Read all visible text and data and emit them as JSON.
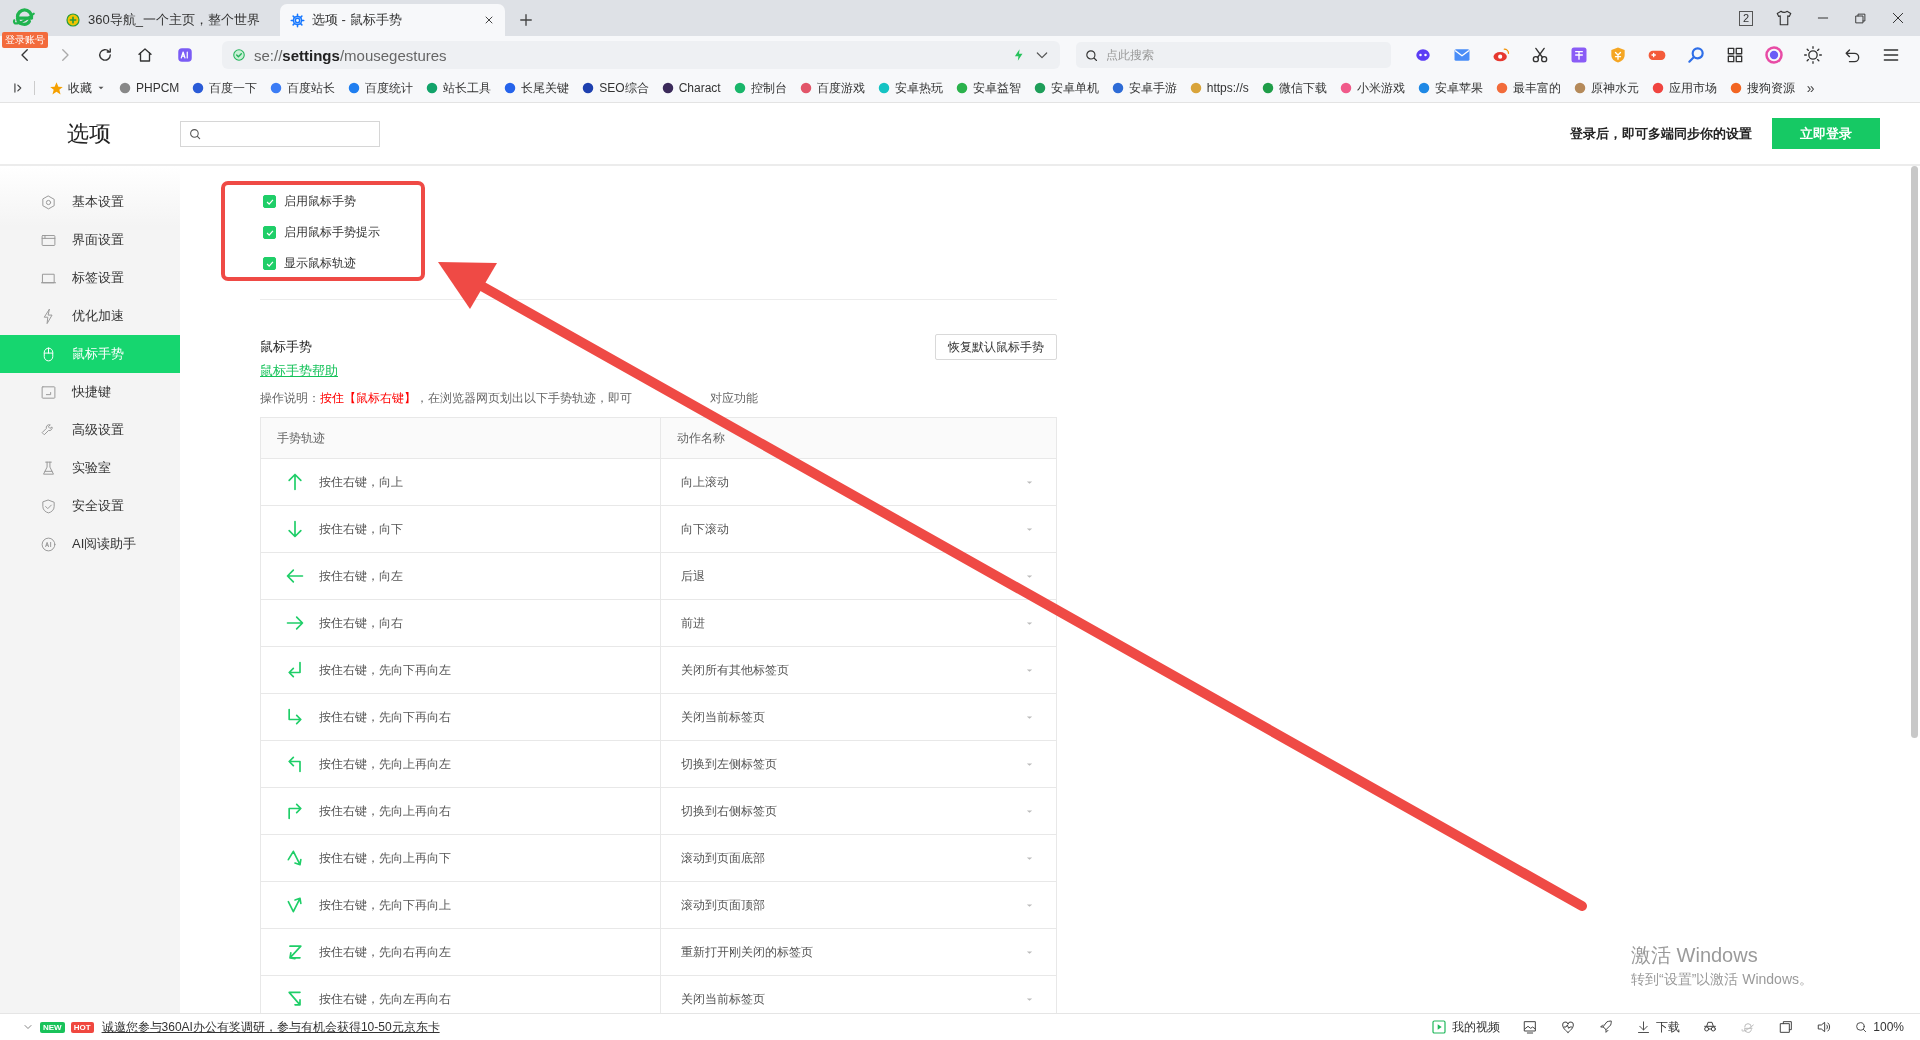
{
  "browser": {
    "account_badge": "登录账号",
    "tabs": [
      {
        "title": "360导航_一个主页，整个世界",
        "selected": false
      },
      {
        "title": "选项 - 鼠标手势",
        "selected": true
      }
    ],
    "tab_count": "2",
    "address": {
      "scheme": "se://",
      "host": "settings",
      "path": "/mousegestures"
    },
    "search": {
      "placeholder": "点此搜索"
    },
    "bookmarks": [
      {
        "label": "收藏"
      },
      {
        "label": "PHPCM"
      },
      {
        "label": "百度一下"
      },
      {
        "label": "百度站长"
      },
      {
        "label": "百度统计"
      },
      {
        "label": "站长工具"
      },
      {
        "label": "长尾关键"
      },
      {
        "label": "SEO综合"
      },
      {
        "label": "Charact"
      },
      {
        "label": "控制台"
      },
      {
        "label": "百度游戏"
      },
      {
        "label": "安卓热玩"
      },
      {
        "label": "安卓益智"
      },
      {
        "label": "安卓单机"
      },
      {
        "label": "安卓手游"
      },
      {
        "label": "https://s"
      },
      {
        "label": "微信下载"
      },
      {
        "label": "小米游戏"
      },
      {
        "label": "安卓苹果"
      },
      {
        "label": "最丰富的"
      },
      {
        "label": "原神水元"
      },
      {
        "label": "应用市场"
      },
      {
        "label": "搜狗资源"
      }
    ],
    "more": "»"
  },
  "settings": {
    "title": "选项",
    "sync_hint": "登录后，即可多端同步你的设置",
    "login_button": "立即登录",
    "sidebar": [
      {
        "label": "基本设置",
        "selected": false
      },
      {
        "label": "界面设置",
        "selected": false
      },
      {
        "label": "标签设置",
        "selected": false
      },
      {
        "label": "优化加速",
        "selected": false
      },
      {
        "label": "鼠标手势",
        "selected": true
      },
      {
        "label": "快捷键",
        "selected": false
      },
      {
        "label": "高级设置",
        "selected": false
      },
      {
        "label": "实验室",
        "selected": false
      },
      {
        "label": "安全设置",
        "selected": false
      },
      {
        "label": "AI阅读助手",
        "selected": false
      }
    ],
    "checkboxes": [
      {
        "label": "启用鼠标手势",
        "checked": true
      },
      {
        "label": "启用鼠标手势提示",
        "checked": true
      },
      {
        "label": "显示鼠标轨迹",
        "checked": true
      }
    ],
    "section_title": "鼠标手势",
    "reset_button": "恢复默认鼠标手势",
    "help_link": "鼠标手势帮助",
    "instruction": {
      "prefix": "操作说明：",
      "highlight": "按住【鼠标右键】",
      "rest": "，在浏览器网页划出以下手势轨迹，即可",
      "tail": "对应功能"
    },
    "table": {
      "columns": [
        "手势轨迹",
        "动作名称"
      ],
      "rows": [
        {
          "kind": "up",
          "gesture": "按住右键，向上",
          "action": "向上滚动"
        },
        {
          "kind": "down",
          "gesture": "按住右键，向下",
          "action": "向下滚动"
        },
        {
          "kind": "left",
          "gesture": "按住右键，向左",
          "action": "后退"
        },
        {
          "kind": "right",
          "gesture": "按住右键，向右",
          "action": "前进"
        },
        {
          "kind": "down-left",
          "gesture": "按住右键，先向下再向左",
          "action": "关闭所有其他标签页"
        },
        {
          "kind": "down-right",
          "gesture": "按住右键，先向下再向右",
          "action": "关闭当前标签页"
        },
        {
          "kind": "up-left",
          "gesture": "按住右键，先向上再向左",
          "action": "切换到左侧标签页"
        },
        {
          "kind": "up-right",
          "gesture": "按住右键，先向上再向右",
          "action": "切换到右侧标签页"
        },
        {
          "kind": "up-down",
          "gesture": "按住右键，先向上再向下",
          "action": "滚动到页面底部"
        },
        {
          "kind": "down-up",
          "gesture": "按住右键，先向下再向上",
          "action": "滚动到页面顶部"
        },
        {
          "kind": "right-left",
          "gesture": "按住右键，先向右再向左",
          "action": "重新打开刚关闭的标签页"
        },
        {
          "kind": "left-right",
          "gesture": "按住右键，先向左再向右",
          "action": "关闭当前标签页"
        }
      ]
    }
  },
  "status_bar": {
    "badges": [
      {
        "text": "NEW",
        "color": "#19c25a"
      },
      {
        "text": "HOT",
        "color": "#f0473f"
      }
    ],
    "survey_link": "诚邀您参与360AI办公有奖调研，参与有机会获得10-50元京东卡",
    "video": "我的视频",
    "download": "下载",
    "zoom": "100%"
  },
  "watermark": {
    "title": "激活 Windows",
    "hint": "转到“设置”以激活 Windows。"
  }
}
